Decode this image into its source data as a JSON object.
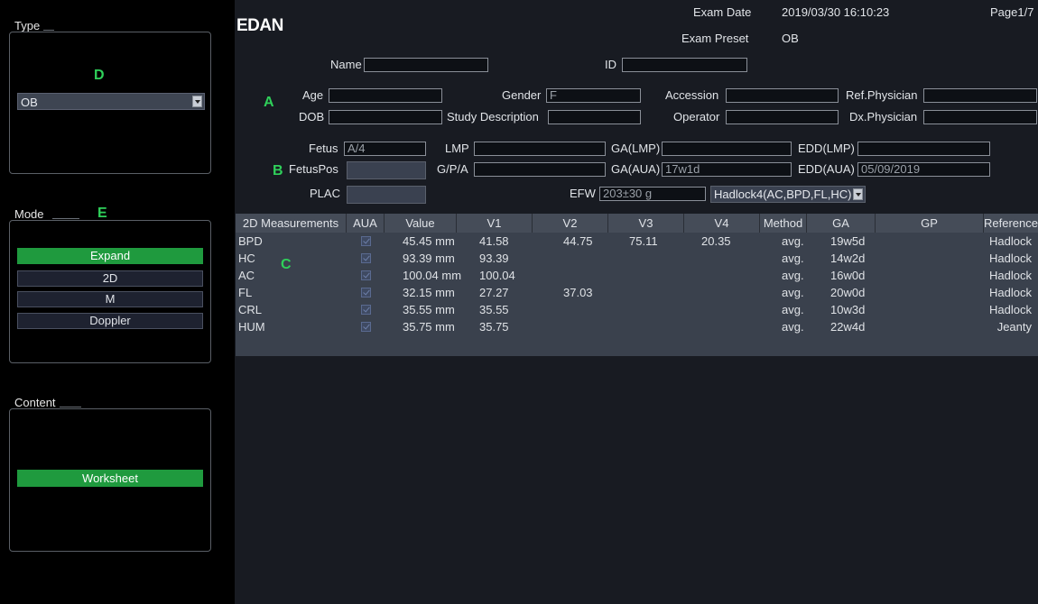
{
  "left": {
    "type": {
      "title": "Type",
      "letter": "D",
      "select_value": "OB"
    },
    "mode": {
      "title": "Mode",
      "letter": "E",
      "buttons": [
        "Expand",
        "2D",
        "M",
        "Doppler"
      ]
    },
    "content": {
      "title": "Content",
      "button": "Worksheet"
    }
  },
  "header": {
    "logo": "EDAN",
    "exam_date_label": "Exam Date",
    "exam_date_value": "2019/03/30 16:10:23",
    "page": "Page1/7",
    "exam_preset_label": "Exam Preset",
    "exam_preset_value": "OB"
  },
  "patient": {
    "letter_a": "A",
    "name_label": "Name",
    "name_value": "",
    "id_label": "ID",
    "id_value": "",
    "age_label": "Age",
    "age_value": "",
    "gender_label": "Gender",
    "gender_value": "F",
    "accession_label": "Accession",
    "accession_value": "",
    "refphys_label": "Ref.Physician",
    "refphys_value": "",
    "dob_label": "DOB",
    "dob_value": "",
    "study_label": "Study Description",
    "study_value": "",
    "operator_label": "Operator",
    "operator_value": "",
    "dxphys_label": "Dx.Physician",
    "dxphys_value": ""
  },
  "ob": {
    "letter_b": "B",
    "fetus_label": "Fetus",
    "fetus_value": "A/4",
    "lmp_label": "LMP",
    "lmp_value": "",
    "galmp_label": "GA(LMP)",
    "galmp_value": "",
    "eddlmp_label": "EDD(LMP)",
    "eddlmp_value": "",
    "fetuspos_label": "FetusPos",
    "fetuspos_value": "",
    "gpa_label": "G/P/A",
    "gpa_value": "",
    "gaaua_label": "GA(AUA)",
    "gaaua_value": "17w1d",
    "eddaua_label": "EDD(AUA)",
    "eddaua_value": "05/09/2019",
    "plac_label": "PLAC",
    "plac_value": "",
    "efw_label": "EFW",
    "efw_value": "203±30 g",
    "efw_method": "Hadlock4(AC,BPD,FL,HC)"
  },
  "table": {
    "letter_c": "C",
    "headers": [
      "2D Measurements",
      "AUA",
      "Value",
      "V1",
      "V2",
      "V3",
      "V4",
      "Method",
      "GA",
      "GP",
      "Reference"
    ],
    "rows": [
      {
        "name": "BPD",
        "value": "45.45 mm",
        "v1": "41.58",
        "v2": "44.75",
        "v3": "75.11",
        "v4": "20.35",
        "method": "avg.",
        "ga": "19w5d",
        "gp": "",
        "ref": "Hadlock"
      },
      {
        "name": "HC",
        "value": "93.39 mm",
        "v1": "93.39",
        "v2": "",
        "v3": "",
        "v4": "",
        "method": "avg.",
        "ga": "14w2d",
        "gp": "",
        "ref": "Hadlock"
      },
      {
        "name": "AC",
        "value": "100.04 mm",
        "v1": "100.04",
        "v2": "",
        "v3": "",
        "v4": "",
        "method": "avg.",
        "ga": "16w0d",
        "gp": "",
        "ref": "Hadlock"
      },
      {
        "name": "FL",
        "value": "32.15 mm",
        "v1": "27.27",
        "v2": "37.03",
        "v3": "",
        "v4": "",
        "method": "avg.",
        "ga": "20w0d",
        "gp": "",
        "ref": "Hadlock"
      },
      {
        "name": "CRL",
        "value": "35.55 mm",
        "v1": "35.55",
        "v2": "",
        "v3": "",
        "v4": "",
        "method": "avg.",
        "ga": "10w3d",
        "gp": "",
        "ref": "Hadlock"
      },
      {
        "name": "HUM",
        "value": "35.75 mm",
        "v1": "35.75",
        "v2": "",
        "v3": "",
        "v4": "",
        "method": "avg.",
        "ga": "22w4d",
        "gp": "",
        "ref": "Jeanty"
      }
    ]
  }
}
